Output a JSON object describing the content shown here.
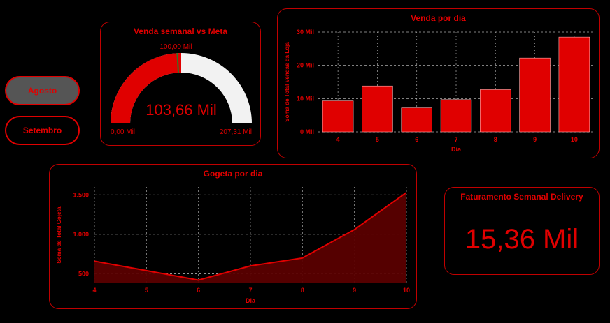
{
  "slicer": {
    "buttons": [
      {
        "label": "Agosto",
        "selected": true
      },
      {
        "label": "Setembro",
        "selected": false
      }
    ]
  },
  "gauge": {
    "title": "Venda semanal vs Meta",
    "value": 103.66,
    "value_label": "103,66 Mil",
    "min": 0,
    "min_label": "0,00 Mil",
    "max": 207.31,
    "max_label": "207,31 Mil",
    "target": 100.0,
    "target_label": "100,00 Mil"
  },
  "delivery": {
    "title": "Faturamento Semanal Delivery",
    "value": "15,36 Mil"
  },
  "colors": {
    "accent": "#e00000",
    "background": "#000000",
    "gauge_track": "#f2f2f2",
    "area_fill": "#5a0000",
    "button_active": "#555555"
  },
  "chart_data": [
    {
      "id": "venda-por-dia",
      "type": "bar",
      "title": "Venda por dia",
      "xlabel": "Dia",
      "ylabel": "Soma de Total Vendas da Loja",
      "categories": [
        "4",
        "5",
        "6",
        "7",
        "8",
        "9",
        "10"
      ],
      "values": [
        9.3,
        13.8,
        7.2,
        9.7,
        12.7,
        22.2,
        28.5
      ],
      "ylim": [
        0,
        30
      ],
      "yticks": [
        0,
        10,
        20,
        30
      ],
      "ytick_labels": [
        "0 Mil",
        "10 Mil",
        "20 Mil",
        "30 Mil"
      ],
      "grid": true
    },
    {
      "id": "gogeta-por-dia",
      "type": "area",
      "title": "Gogeta por dia",
      "xlabel": "Dia",
      "ylabel": "Soma de Total Gojeta",
      "x": [
        4,
        5,
        6,
        7,
        8,
        9,
        10
      ],
      "values": [
        660,
        540,
        420,
        600,
        700,
        1060,
        1530
      ],
      "xlim": [
        4,
        10
      ],
      "ylim": [
        380,
        1600
      ],
      "yticks": [
        500,
        1000,
        1500
      ],
      "ytick_labels": [
        "500",
        "1.000",
        "1.500"
      ],
      "grid": true
    }
  ]
}
